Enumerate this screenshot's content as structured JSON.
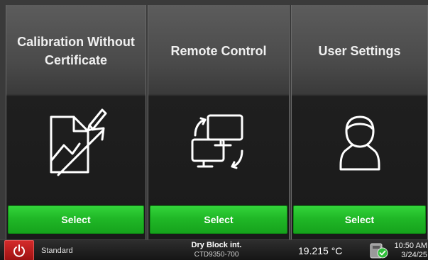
{
  "tiles": [
    {
      "title": "Calibration Without Certificate",
      "icon": "document-chart-edit-icon",
      "button": "Select"
    },
    {
      "title": "Remote Control",
      "icon": "remote-monitors-icon",
      "button": "Select"
    },
    {
      "title": "User Settings",
      "icon": "user-icon",
      "button": "Select"
    }
  ],
  "statusbar": {
    "power_icon": "power-icon",
    "mode": "Standard",
    "device_name": "Dry Block int.",
    "device_model": "CTD9350-700",
    "temperature": "19.215 °C",
    "status_icon": "device-ok-icon",
    "time": "10:50 AM",
    "date": "3/24/25"
  },
  "colors": {
    "select_green": "#20b827",
    "power_red": "#c41e1e",
    "background": "#1e1e1e"
  }
}
